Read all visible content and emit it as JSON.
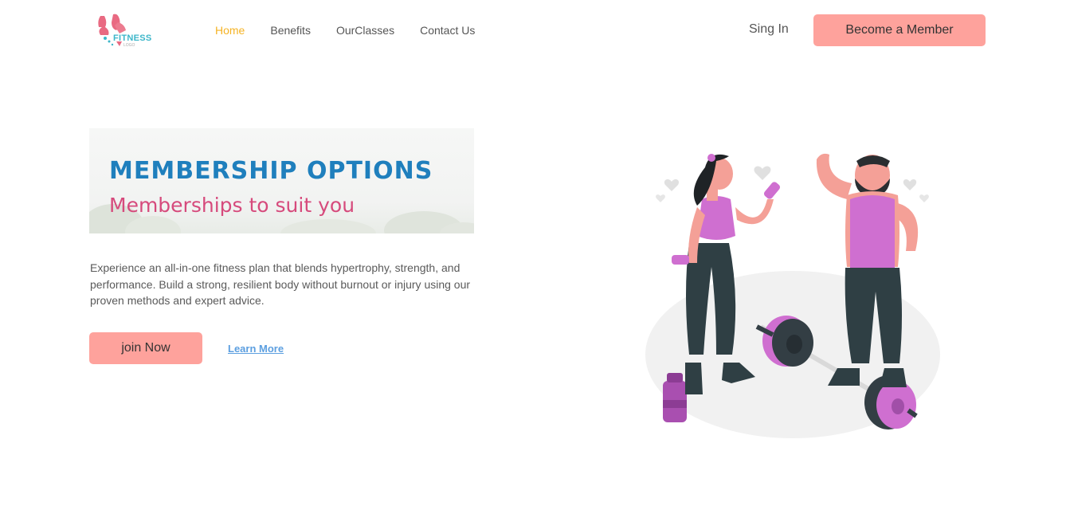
{
  "logo": {
    "text": "FITNESS",
    "sub": "LOGO",
    "icon": "fitness-logo-icon"
  },
  "nav": {
    "links": [
      {
        "label": "Home",
        "active": true
      },
      {
        "label": "Benefits",
        "active": false
      },
      {
        "label": "OurClasses",
        "active": false
      },
      {
        "label": "Contact Us",
        "active": false
      }
    ],
    "signin_label": "Sing In",
    "member_button_label": "Become a Member"
  },
  "hero": {
    "banner_title": "MEMBERSHIP OPTIONS",
    "banner_subtitle": "Memberships to suit you",
    "description": "Experience an all-in-one fitness plan that blends hypertrophy, strength, and performance. Build a strong, resilient body without burnout or injury using our proven methods and expert advice.",
    "join_label": "join Now",
    "learn_label": "Learn More"
  },
  "colors": {
    "accent": "#fea29c",
    "active_nav": "#f5b324",
    "banner_title": "#1f7fbd",
    "banner_subtitle": "#d64a7c",
    "link": "#5c9fe0"
  }
}
